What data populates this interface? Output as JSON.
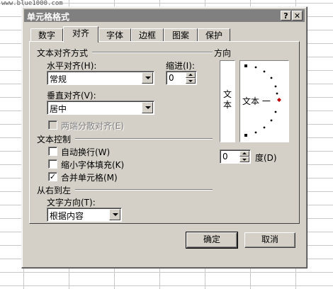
{
  "watermark": "www.blue1000.com",
  "dialog": {
    "title": "单元格格式",
    "help_button": "?",
    "close_button": "✕"
  },
  "tabs": [
    "数字",
    "对齐",
    "字体",
    "边框",
    "图案",
    "保护"
  ],
  "active_tab": "对齐",
  "text_alignment": {
    "section_title": "文本对齐方式",
    "horizontal_label": "水平对齐(H):",
    "horizontal_value": "常规",
    "indent_label": "缩进(I):",
    "indent_value": "0",
    "vertical_label": "垂直对齐(V):",
    "vertical_value": "居中",
    "justify_distributed_label": "两端分散对齐(E)"
  },
  "text_control": {
    "section_title": "文本控制",
    "wrap_text_label": "自动换行(W)",
    "wrap_text_checked": false,
    "shrink_to_fit_label": "缩小字体填充(K)",
    "shrink_to_fit_checked": false,
    "merge_cells_label": "合并单元格(M)",
    "merge_cells_checked": true
  },
  "rtl": {
    "section_title": "从右到左",
    "direction_label": "文字方向(T):",
    "direction_value": "根据内容"
  },
  "orientation": {
    "section_title": "方向",
    "vertical_text": "文本",
    "horizontal_text": "文本 一",
    "degrees_value": "0",
    "degrees_label": "度(D)"
  },
  "buttons": {
    "ok": "确定",
    "cancel": "取消"
  }
}
